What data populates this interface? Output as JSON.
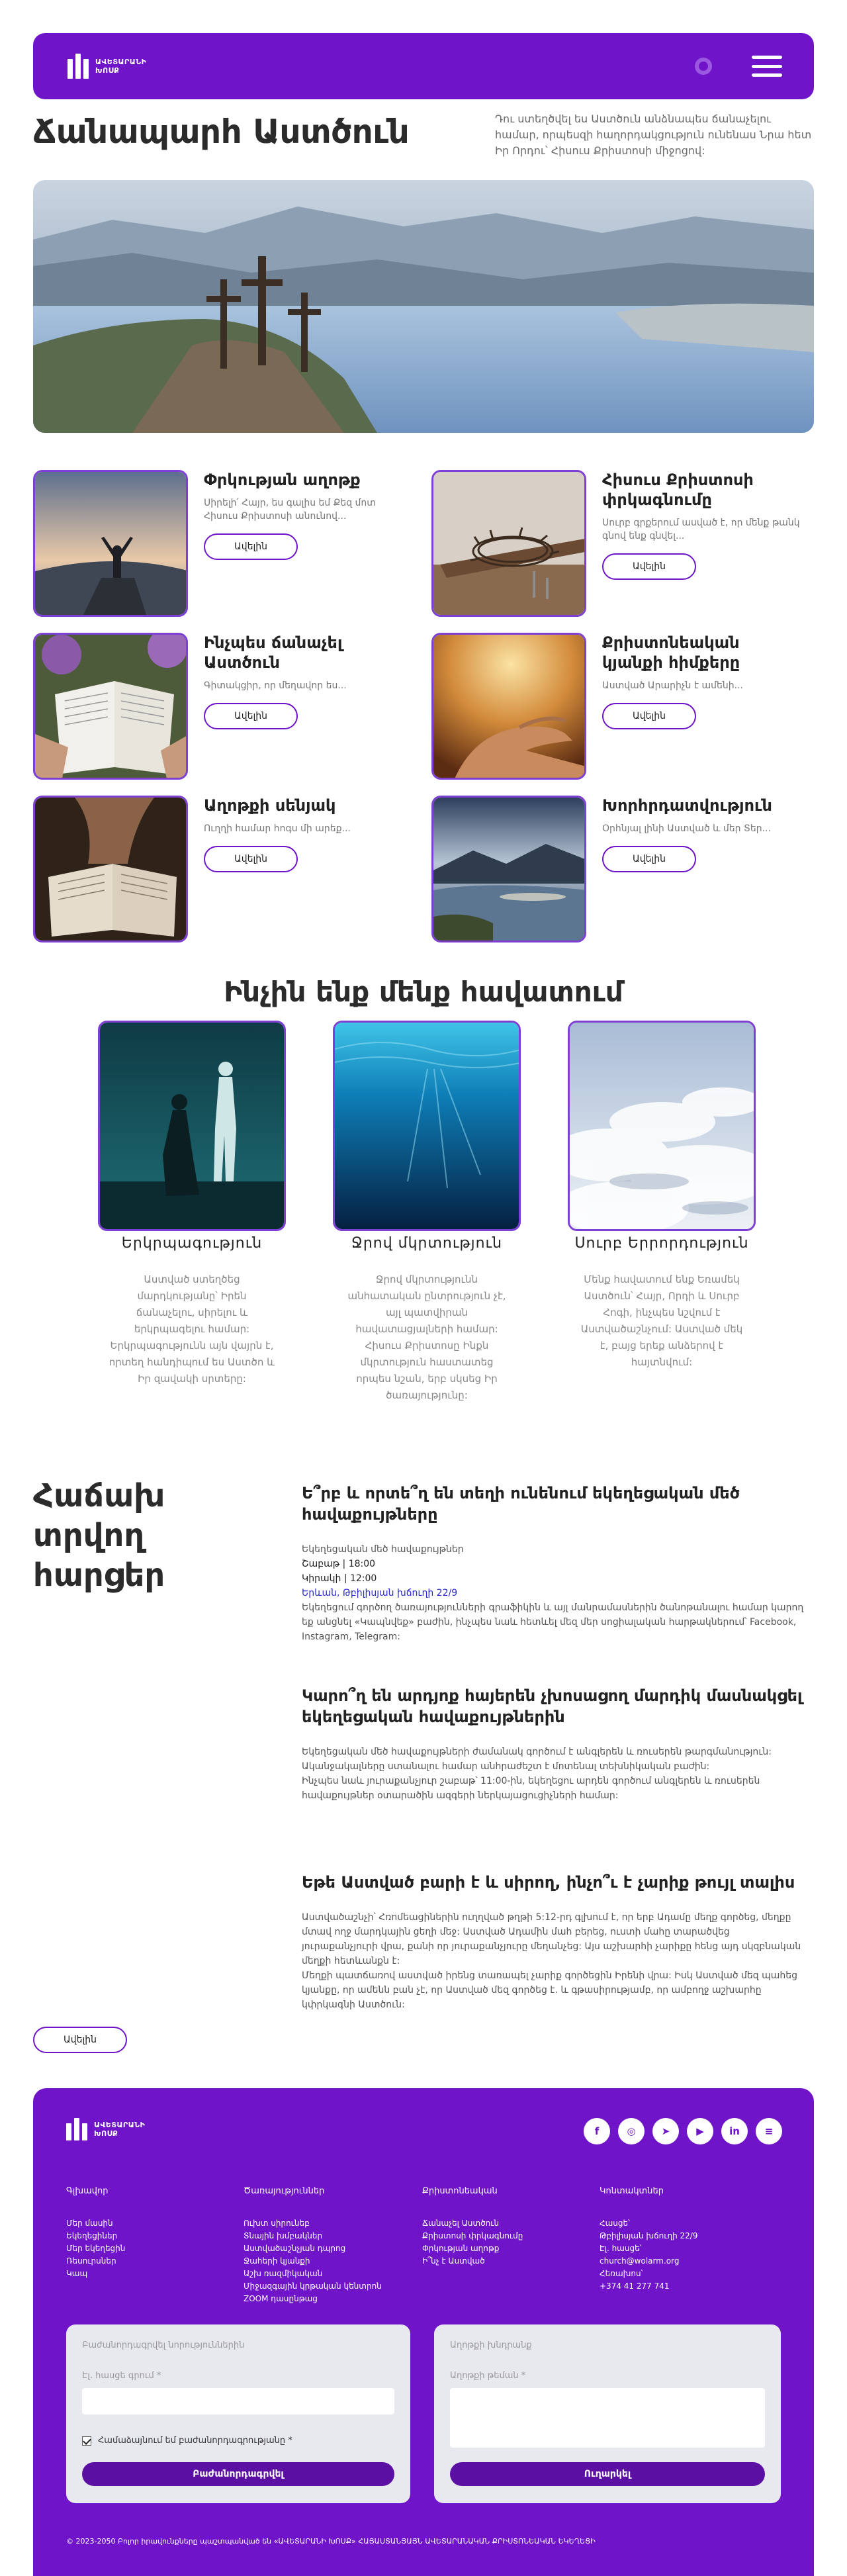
{
  "header": {
    "logo_line1": "ԱՎԵՏԱՐԱՆԻ",
    "logo_line2": "ԽՈՍՔ"
  },
  "hero": {
    "title": "Ճանապարհ Աստծուն",
    "lead": "Դու ստեղծվել ես Աստծուն անձնապես ճանաչելու համար, որպեսզի հաղորդակցություն ունենաս Նրա հետ Իր Որդու՝ Հիսուս Քրիստոսի միջոցով:"
  },
  "cards": [
    {
      "title": "Փրկության աղոթք",
      "text": "Սիրելի՛ Հայր, ես գալիս եմ Քեզ մոտ Հիսուս Քրիստոսի անունով...",
      "button": "Ավելին"
    },
    {
      "title": "Հիսուս Քրիստոսի փրկագնումը",
      "text": "Սուրբ գրքերում ասված է, որ մենք թանկ գնով ենք գնվել...",
      "button": "Ավելին"
    },
    {
      "title": "Ինչպես ճանաչել Աստծուն",
      "text": "Գիտակցիր, որ մեղավոր ես...",
      "button": "Ավելին"
    },
    {
      "title": "Քրիստոնեական կյանքի հիմքերը",
      "text": "Աստված Արարիչն է ամենի...",
      "button": "Ավելին"
    },
    {
      "title": "Աղոթքի սենյակ",
      "text": "Ուղղի համար հոգս մի արեք...",
      "button": "Ավելին"
    },
    {
      "title": "Խորհրդատվություն",
      "text": "Օրհնյալ լինի Աստված և մեր Տեր...",
      "button": "Ավելին"
    }
  ],
  "beliefs": {
    "title": "Ինչին ենք մենք հավատում",
    "items": [
      {
        "title": "Երկրպագություն",
        "text": "Աստված ստեղծեց մարդկությանը՝ Իրեն ճանաչելու, սիրելու և երկրպագելու համար: Երկրպագությունն այն վայրն է, որտեղ հանդիպում ես Աստծո և Իր զավակի սրտերը:"
      },
      {
        "title": "Ջրով մկրտություն",
        "text": "Ջրով մկրտությունն անհատական ընտրություն չէ, այլ պատվիրան հավատացյալների համար: Հիսուս Քրիստոսը Ինքն մկրտություն հաստատեց որպես նշան, երբ սկսեց Իր ծառայությունը:"
      },
      {
        "title": "Սուրբ Երրորդություն",
        "text": "Մենք հավատում ենք Եռամեկ Աստծուն՝ Հայր, Որդի և Սուրբ Հոգի, ինչպես նշվում է Աստվածաշնչում: Աստված մեկ է, բայց երեք անձերով է հայտնվում:"
      }
    ]
  },
  "faq": {
    "title": "Հաճախ տրվող հարցեր",
    "items": [
      {
        "question": "Ե՞րբ և որտե՞ղ են տեղի ունենում եկեղեցական մեծ հավաքույթները",
        "lines": [
          "Եկեղեցական մեծ հավաքույթներ",
          "Շաբաթ | 18:00",
          "Կիրակի | 12:00",
          "Երևան, Թբիլիսյան խճուղի 22/9",
          "Եկեղեցում գործող ծառայությունների գրաֆիկին և այլ մանրամասներին ծանոթանալու համար կարող եք անցնել «Կապնվեք» բաժին, ինչպես նաև հետևել մեզ մեր սոցիալական հարթակներում՝ Facebook, Instagram, Telegram:"
        ]
      },
      {
        "question": "Կարո՞ղ են արդյոք հայերեն չխոսացող մարդիկ մասնակցել եկեղեցական հավաքույթներին",
        "lines": [
          "Եկեղեցական մեծ հավաքույթների ժամանակ գործում է անգլերեն և ռուսերեն թարգմանություն: Ականջակալները ստանալու համար անհրաժեշտ է մոտենալ տեխնիկական բաժին:",
          "Ինչպես նաև յուրաքանչյուր շաբաթ՝ 11:00-ին, եկեղեցու արդեն գործում անգլերեն և ռուսերեն հավաքույթներ օտարածին ազգերի ներկայացուցիչների համար:"
        ]
      },
      {
        "question": "Եթե Աստված բարի է և սիրող, ինչո՞ւ է չարիք թույլ տալիս",
        "lines": [
          "Աստվածաշնչի՝ Հռոմեացիներին ուղղված թղթի 5:12-րդ գլխում է, որ երբ Ադամը մեղք գործեց, մեղքը մտավ ողջ մարդկային ցեղի մեջ: Աստված Ադամին մահ բերեց, ուստի մահը տարածվեց յուրաքանչյուրի վրա, քանի որ յուրաքանչյուրը մեղանչեց: Այս աշխարհի չարիքը հենց այդ սկզբնական մեղքի հետևանքն է:",
          "Մեղքի պատճառով աստված իրենց տառապել չարիք գործեցին Իրենի վրա: Իսկ Աստված մեզ պահեց կյանքը, որ ամենն բան չէ, որ Աստված մեզ գործեց է. և գթասիրությամբ, որ ամբողջ աշխարհը կփրկագնի Աստծուն:"
        ]
      }
    ],
    "more_button": "Ավելին"
  },
  "footer": {
    "logo_line1": "ԱՎԵՏԱՐԱՆԻ",
    "logo_line2": "ԽՈՍՔ",
    "socials": [
      {
        "icon": "facebook-icon",
        "glyph": "f"
      },
      {
        "icon": "instagram-icon",
        "glyph": "◎"
      },
      {
        "icon": "telegram-icon",
        "glyph": "➤"
      },
      {
        "icon": "youtube-icon",
        "glyph": "▶"
      },
      {
        "icon": "linkedin-icon",
        "glyph": "in"
      },
      {
        "icon": "menu-icon",
        "glyph": "≡"
      }
    ],
    "columns": [
      {
        "heading": "Գլխավոր",
        "links": [
          "Մեր մասին",
          "Եկեղեցիներ",
          "Մեր եկեղեցին",
          "Ռեսուրսներ",
          "Կապ"
        ]
      },
      {
        "heading": "Ծառայություններ",
        "links": [
          "Ուխտ սիրունեբ",
          "Տնային խմբակներ",
          "Աստվածաշնչյան դպրոց",
          "Ջահերի կյանքի",
          "Աշխ ռազմիկական",
          "Միջազգային կրթական կենտրոն",
          "ZOOM դասընթաց"
        ]
      },
      {
        "heading": "Քրիստոնեական",
        "links": [
          "Ճանաչել Աստծուն",
          "Քրիստոսի փրկագնումը",
          "Փրկության աղոթք",
          "Ի՞նչ է Աստված"
        ]
      },
      {
        "heading": "Կոնտակտներ",
        "links": [
          "Հասցե՝",
          "Թբիլիսյան խճուղի 22/9",
          "Էլ. հասցե՝",
          "church@wolarm.org",
          "Հեռախոս՝",
          "+374 41 277 741"
        ]
      }
    ],
    "subscribe": {
      "title": "Բաժանորդագրվել նորություններին",
      "email_label": "Էլ. հասցե գրում *",
      "consent": "Համաձայնում եմ բաժանորդագրությանը *",
      "button": "Բաժանորդագրվել"
    },
    "prayer": {
      "title": "Աղոթքի խնդրանք",
      "message_label": "Աղոթքի թեման *",
      "button": "Ուղարկել"
    },
    "copyright": "© 2023-2050 Բոլոր իրավունքները պաշտպանված են «ԱՎԵՏԱՐԱՆԻ ԽՈՍՔ» ՀԱՅԱՍՏԱՆՅԱՅՆ ԱՎԵՏԱՐԱՆԱԿԱՆ ՔՐԻՍՏՈՆԵԱԿԱՆ ԵԿԵՂԵՑԻ"
  }
}
